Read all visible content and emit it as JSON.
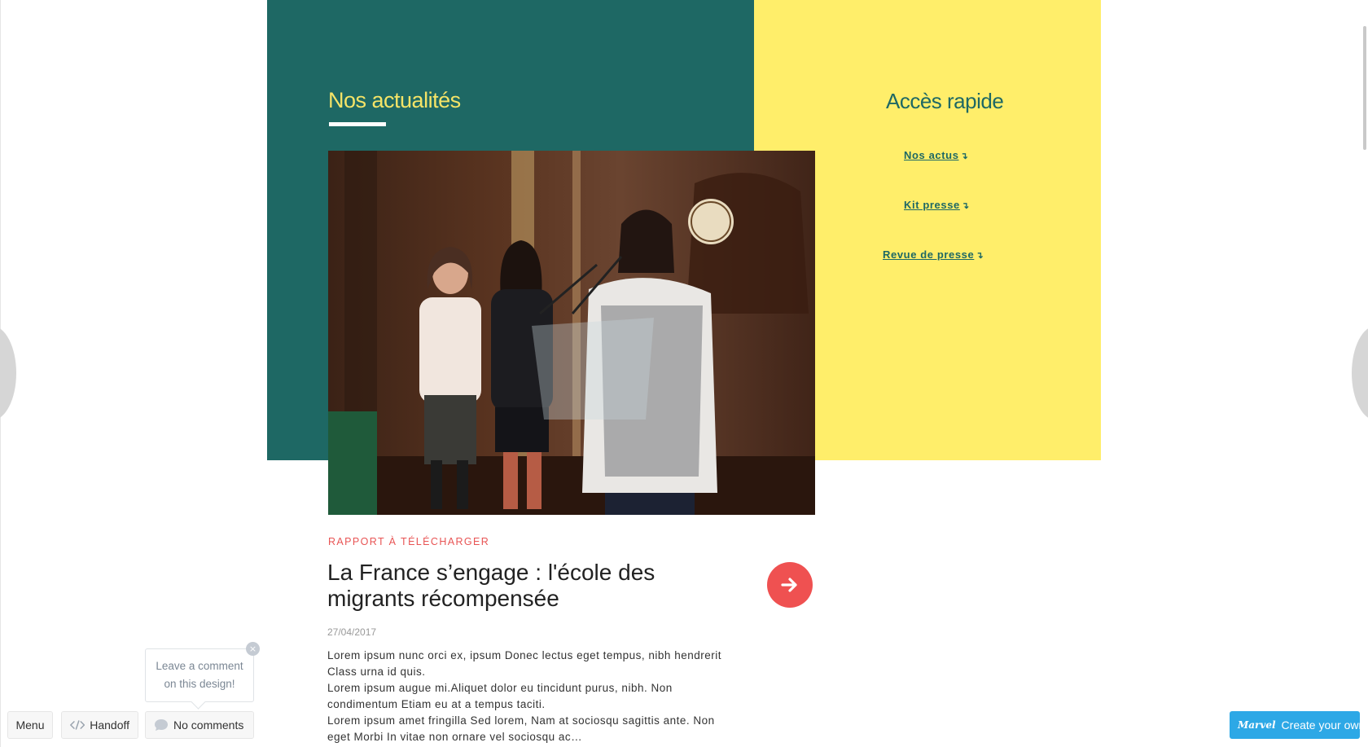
{
  "news": {
    "title": "Nos actualités",
    "category": "RAPPORT À TÉLÉCHARGER",
    "article_title": "La France s’engage : l'école des migrants récompensée",
    "date": "27/04/2017",
    "excerpt": [
      "Lorem ipsum nunc orci ex, ipsum Donec lectus eget tempus, nibh hendrerit Class urna id quis.",
      "Lorem ipsum augue mi.Aliquet dolor eu tincidunt purus, nibh. Non condimentum Etiam eu at a tempus taciti.",
      "Lorem ipsum amet fringilla Sed lorem, Nam at sociosqu sagittis ante. Non eget Morbi In vitae non ornare vel sociosqu ac…"
    ]
  },
  "quick_access": {
    "title": "Accès rapide",
    "links": [
      "Nos actus",
      "Kit presse",
      "Revue de presse"
    ],
    "link_arrow": "↴"
  },
  "toolbar": {
    "menu_label": "Menu",
    "handoff_label": "Handoff",
    "comments_label": "No comments",
    "tooltip_line1": "Leave a comment",
    "tooltip_line2": "on this design!",
    "create_label": "Create your own",
    "logo_text": "Marvel"
  },
  "icons": {
    "arrow_button": "arrow-right-icon",
    "handoff": "code-icon",
    "comments": "speech-bubble-icon",
    "close": "close-icon"
  },
  "colors": {
    "green": "#1e6864",
    "yellow": "#ffee6a",
    "accent_red": "#ef5151",
    "create_blue": "#2da8e6"
  }
}
